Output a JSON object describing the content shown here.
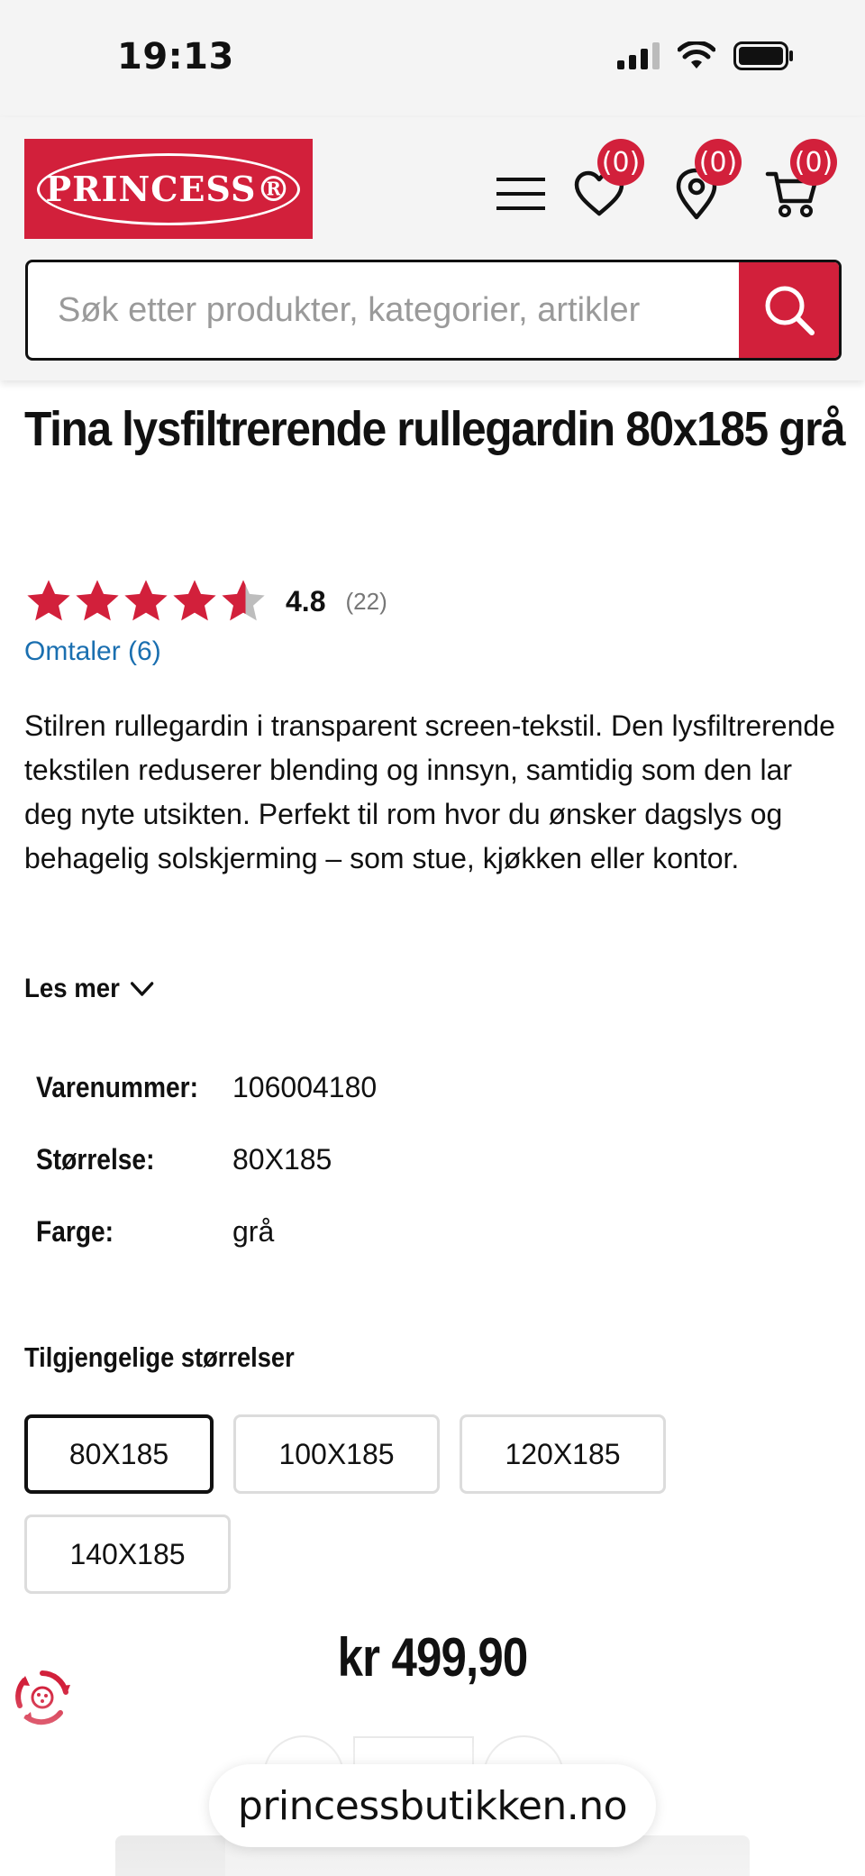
{
  "status_bar": {
    "time": "19:13"
  },
  "header": {
    "logo_text": "PRINCESS®",
    "wishlist_count": "(0)",
    "stores_count": "(0)",
    "cart_count": "(0)",
    "search": {
      "placeholder": "Søk etter produkter, kategorier, artikler",
      "value": ""
    }
  },
  "product": {
    "title": "Tina lysfiltrerende rullegardin 80x185 grå",
    "rating": {
      "value": "4.8",
      "count": "(22)",
      "stars_filled": 4.8,
      "stars_max": 5
    },
    "reviews_link": "Omtaler (6)",
    "description": "Stilren rullegardin i transparent screen-tekstil. Den lysfiltrerende tekstilen reduserer blending og innsyn, samtidig som den lar deg nyte utsikten. Perfekt til rom hvor du ønsker dagslys og behagelig solskjerming – som stue, kjøkken eller kontor.",
    "read_more": "Les mer",
    "specs": [
      {
        "label": "Varenummer:",
        "value": "106004180"
      },
      {
        "label": "Størrelse:",
        "value": "80X185"
      },
      {
        "label": "Farge:",
        "value": "grå"
      }
    ],
    "sizes_title": "Tilgjengelige størrelser",
    "sizes": [
      "80X185",
      "100X185",
      "120X185",
      "140X185"
    ],
    "selected_size": "80X185",
    "price": "kr 499,90"
  },
  "quantity": {
    "minus_label": "–",
    "plus_label": "+"
  },
  "browser": {
    "url": "princessbutikken.no"
  },
  "colors": {
    "brand_red": "#d2203b",
    "link_blue": "#1a6fb0",
    "header_bg": "#f4f4f4"
  }
}
